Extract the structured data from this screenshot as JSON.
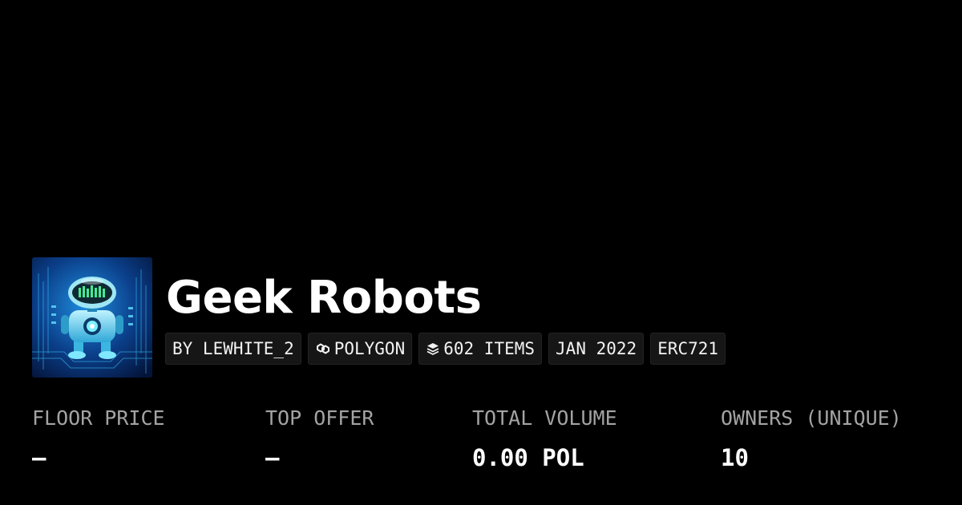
{
  "collection": {
    "name": "Geek Robots",
    "image_icon": "robot-artwork"
  },
  "chips": {
    "creator": "BY LEWHITE_2",
    "chain": "POLYGON",
    "chain_icon": "polygon-chain-icon",
    "items": "602 ITEMS",
    "items_icon": "layers-icon",
    "date": "JAN 2022",
    "standard": "ERC721"
  },
  "stats": {
    "floor_price": {
      "label": "FLOOR PRICE",
      "value": "–"
    },
    "top_offer": {
      "label": "TOP OFFER",
      "value": "–"
    },
    "total_volume": {
      "label": "TOTAL VOLUME",
      "value": "0.00 POL"
    },
    "owners": {
      "label": "OWNERS (UNIQUE)",
      "value": "10"
    }
  },
  "colors": {
    "background": "#000000",
    "chip_background": "#161616",
    "label": "#a3a3a3",
    "text": "#ffffff"
  }
}
